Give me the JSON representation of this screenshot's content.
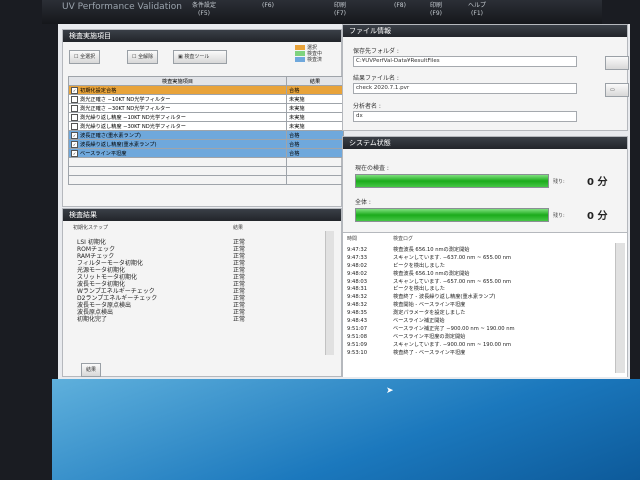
{
  "title_bar": {
    "app_title": "UV Performance Validation",
    "tools": [
      {
        "name": "条件設定",
        "key": "(F5)"
      },
      {
        "name": "",
        "key": "(F6)"
      },
      {
        "name": "印刷",
        "key": "(F7)"
      },
      {
        "name": "",
        "key": "(F8)"
      },
      {
        "name": "印刷",
        "key": "(F9)"
      },
      {
        "name": "ヘルプ",
        "key": "(F1)"
      }
    ]
  },
  "inspection_items": {
    "title": "検査実施項目",
    "buttons": {
      "select_all": "全選択",
      "deselect_all": "全解除",
      "tool": "検査ツール"
    },
    "legend": [
      {
        "label": "選択",
        "color": "#e8a33a"
      },
      {
        "label": "検査中",
        "color": "#7fd37f"
      },
      {
        "label": "検査済",
        "color": "#6fa8dc"
      }
    ],
    "headers": [
      "検査実施項目",
      "結果"
    ],
    "rows": [
      {
        "checked": true,
        "item": "初期化設定合格",
        "result": "合格",
        "state": "selected"
      },
      {
        "checked": false,
        "item": "測光正確さ −10KT ND光学フィルター",
        "result": "未実施",
        "state": "none"
      },
      {
        "checked": false,
        "item": "測光正確さ −30KT ND光学フィルター",
        "result": "未実施",
        "state": "none"
      },
      {
        "checked": false,
        "item": "測光繰り返し精度 −10KT ND光学フィルター",
        "result": "未実施",
        "state": "none"
      },
      {
        "checked": false,
        "item": "測光繰り返し精度 −30KT ND光学フィルター",
        "result": "未実施",
        "state": "none"
      },
      {
        "checked": true,
        "item": "波長正確さ(重水素ランプ)",
        "result": "合格",
        "state": "done"
      },
      {
        "checked": true,
        "item": "波長繰り返し精度(重水素ランプ)",
        "result": "合格",
        "state": "done"
      },
      {
        "checked": true,
        "item": "ベースライン平坦度",
        "result": "合格",
        "state": "done"
      }
    ]
  },
  "inspection_results": {
    "title": "検査結果",
    "headers": [
      "初期化ステップ",
      "結果"
    ],
    "rows": [
      {
        "step": "LSI 初期化",
        "result": "正常"
      },
      {
        "step": "ROMチェック",
        "result": "正常"
      },
      {
        "step": "RAMチェック",
        "result": "正常"
      },
      {
        "step": "フィルターモータ初期化",
        "result": "正常"
      },
      {
        "step": "光源モータ初期化",
        "result": "正常"
      },
      {
        "step": "スリットモータ初期化",
        "result": "正常"
      },
      {
        "step": "波長モータ初期化",
        "result": "正常"
      },
      {
        "step": "Wランプエネルギーチェック",
        "result": "正常"
      },
      {
        "step": "D2ランプエネルギーチェック",
        "result": "正常"
      },
      {
        "step": "波長モータ原点検出",
        "result": "正常"
      },
      {
        "step": "波長原点検出",
        "result": "正常"
      },
      {
        "step": "初期化完了",
        "result": "正常"
      }
    ],
    "tab": "結果"
  },
  "file_info": {
    "title": "ファイル情報",
    "save_folder_label": "保存先フォルダ :",
    "save_folder_value": "C:¥UVPerfVal-Data¥ResultFiles",
    "result_file_label": "結果ファイル名 :",
    "result_file_value": "check 2020.7.1.pvr",
    "analyst_label": "分析者名 :",
    "analyst_value": "dx"
  },
  "system_status": {
    "title": "システム状態",
    "current_label": "現在の検査 :",
    "current_progress": 1.0,
    "current_unit": "残り:",
    "current_time": "0 分",
    "total_label": "全体 :",
    "total_progress": 1.0,
    "total_unit": "残り:",
    "total_time": "0 分"
  },
  "log": {
    "headers": [
      "時間",
      "検査ログ"
    ],
    "rows": [
      {
        "time": "9:47:32",
        "msg": "検査波長 656.10 nmの測定開始"
      },
      {
        "time": "9:47:33",
        "msg": "スキャンしています. −637.00 nm ~ 655.00 nm"
      },
      {
        "time": "9:48:02",
        "msg": "ピークを検出しました"
      },
      {
        "time": "9:48:02",
        "msg": "検査波長 656.10 nmの測定開始"
      },
      {
        "time": "9:48:03",
        "msg": "スキャンしています. −657.00 nm ~ 655.00 nm"
      },
      {
        "time": "9:48:31",
        "msg": "ピークを検出しました"
      },
      {
        "time": "9:48:32",
        "msg": "検査終了 - 波長繰り返し精度(重水素ランプ)"
      },
      {
        "time": "9:48:32",
        "msg": "検査開始 - ベースライン平坦度"
      },
      {
        "time": "9:48:35",
        "msg": "測定パラメータを設定しました"
      },
      {
        "time": "9:48:43",
        "msg": "ベースライン補正開始"
      },
      {
        "time": "9:51:07",
        "msg": "ベースライン補正完了 −900.00 nm ~ 190.00 nm"
      },
      {
        "time": "9:51:08",
        "msg": "ベースライン平坦度の測定開始"
      },
      {
        "time": "9:51:09",
        "msg": "スキャンしています. −900.00 nm ~ 190.00 nm"
      },
      {
        "time": "9:53:10",
        "msg": "検査終了 - ベースライン平坦度"
      }
    ]
  }
}
